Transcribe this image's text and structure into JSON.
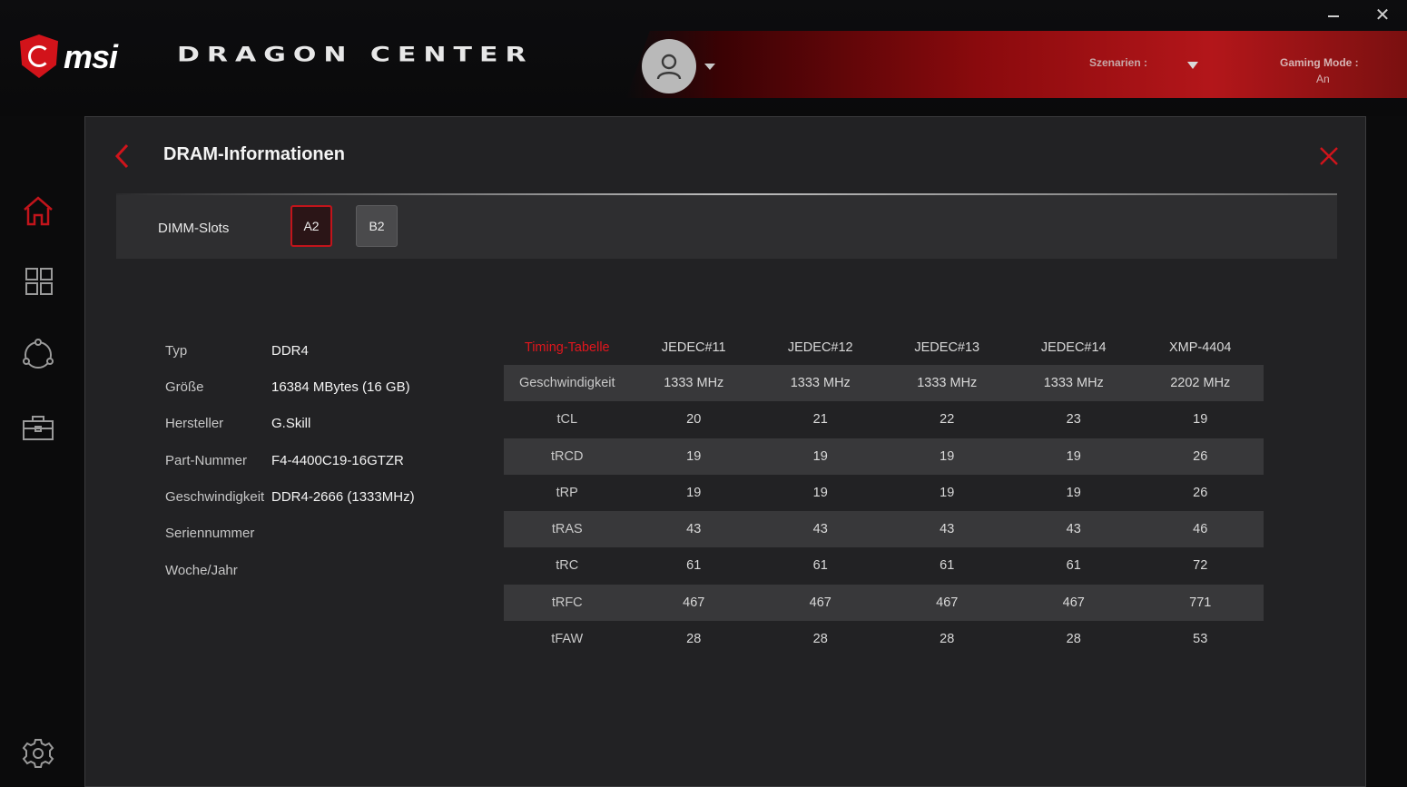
{
  "header": {
    "brand": "msi",
    "app_title": "DRAGON CENTER",
    "scenario_label": "Szenarien :",
    "gaming_mode_label": "Gaming Mode :",
    "gaming_mode_value": "An",
    "accent_color": "#c2141b"
  },
  "sidebar": {
    "items": [
      {
        "name": "home",
        "icon": "home-icon",
        "active": true
      },
      {
        "name": "apps",
        "icon": "grid-icon"
      },
      {
        "name": "network",
        "icon": "network-icon"
      },
      {
        "name": "toolbox",
        "icon": "toolbox-icon"
      },
      {
        "name": "settings",
        "icon": "gear-icon"
      }
    ]
  },
  "panel": {
    "title": "DRAM-Informationen",
    "dimm_label": "DIMM-Slots",
    "slots": [
      {
        "label": "A2",
        "selected": true
      },
      {
        "label": "B2",
        "selected": false
      }
    ],
    "info": [
      {
        "key": "Typ",
        "value": "DDR4"
      },
      {
        "key": "Größe",
        "value": "16384 MBytes (16 GB)"
      },
      {
        "key": "Hersteller",
        "value": "G.Skill"
      },
      {
        "key": "Part-Nummer",
        "value": "F4-4400C19-16GTZR"
      },
      {
        "key": "Geschwindigkeit",
        "value": "DDR4-2666 (1333MHz)"
      },
      {
        "key": "Seriennummer",
        "value": ""
      },
      {
        "key": "Woche/Jahr",
        "value": ""
      }
    ],
    "timing": {
      "header": [
        "Timing-Tabelle",
        "JEDEC#11",
        "JEDEC#12",
        "JEDEC#13",
        "JEDEC#14",
        "XMP-4404"
      ],
      "rows": [
        [
          "Geschwindigkeit",
          "1333 MHz",
          "1333 MHz",
          "1333 MHz",
          "1333 MHz",
          "2202 MHz"
        ],
        [
          "tCL",
          "20",
          "21",
          "22",
          "23",
          "19"
        ],
        [
          "tRCD",
          "19",
          "19",
          "19",
          "19",
          "26"
        ],
        [
          "tRP",
          "19",
          "19",
          "19",
          "19",
          "26"
        ],
        [
          "tRAS",
          "43",
          "43",
          "43",
          "43",
          "46"
        ],
        [
          "tRC",
          "61",
          "61",
          "61",
          "61",
          "72"
        ],
        [
          "tRFC",
          "467",
          "467",
          "467",
          "467",
          "771"
        ],
        [
          "tFAW",
          "28",
          "28",
          "28",
          "28",
          "53"
        ]
      ]
    }
  }
}
